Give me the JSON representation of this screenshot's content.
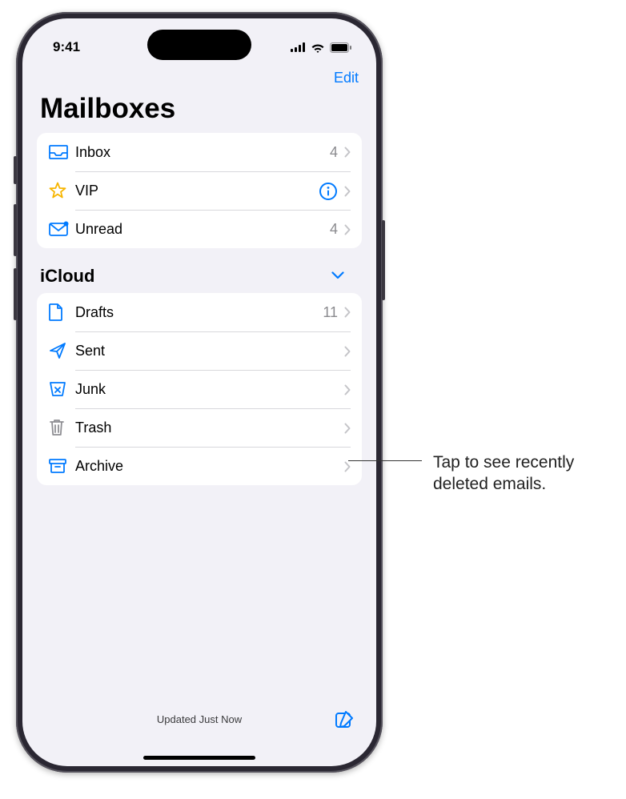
{
  "status": {
    "time": "9:41"
  },
  "nav": {
    "edit": "Edit"
  },
  "title": "Mailboxes",
  "smart": [
    {
      "icon": "inbox",
      "label": "Inbox",
      "count": "4",
      "name": "mailbox-inbox"
    },
    {
      "icon": "star",
      "label": "VIP",
      "info": true,
      "name": "mailbox-vip"
    },
    {
      "icon": "unread",
      "label": "Unread",
      "count": "4",
      "name": "mailbox-unread"
    }
  ],
  "account": {
    "header": "iCloud",
    "rows": [
      {
        "icon": "draft",
        "label": "Drafts",
        "count": "11",
        "name": "mailbox-drafts"
      },
      {
        "icon": "sent",
        "label": "Sent",
        "name": "mailbox-sent"
      },
      {
        "icon": "junk",
        "label": "Junk",
        "name": "mailbox-junk"
      },
      {
        "icon": "trash",
        "label": "Trash",
        "name": "mailbox-trash"
      },
      {
        "icon": "archive",
        "label": "Archive",
        "name": "mailbox-archive"
      }
    ]
  },
  "toolbar": {
    "status": "Updated Just Now"
  },
  "callout": {
    "text": "Tap to see recently deleted emails."
  }
}
